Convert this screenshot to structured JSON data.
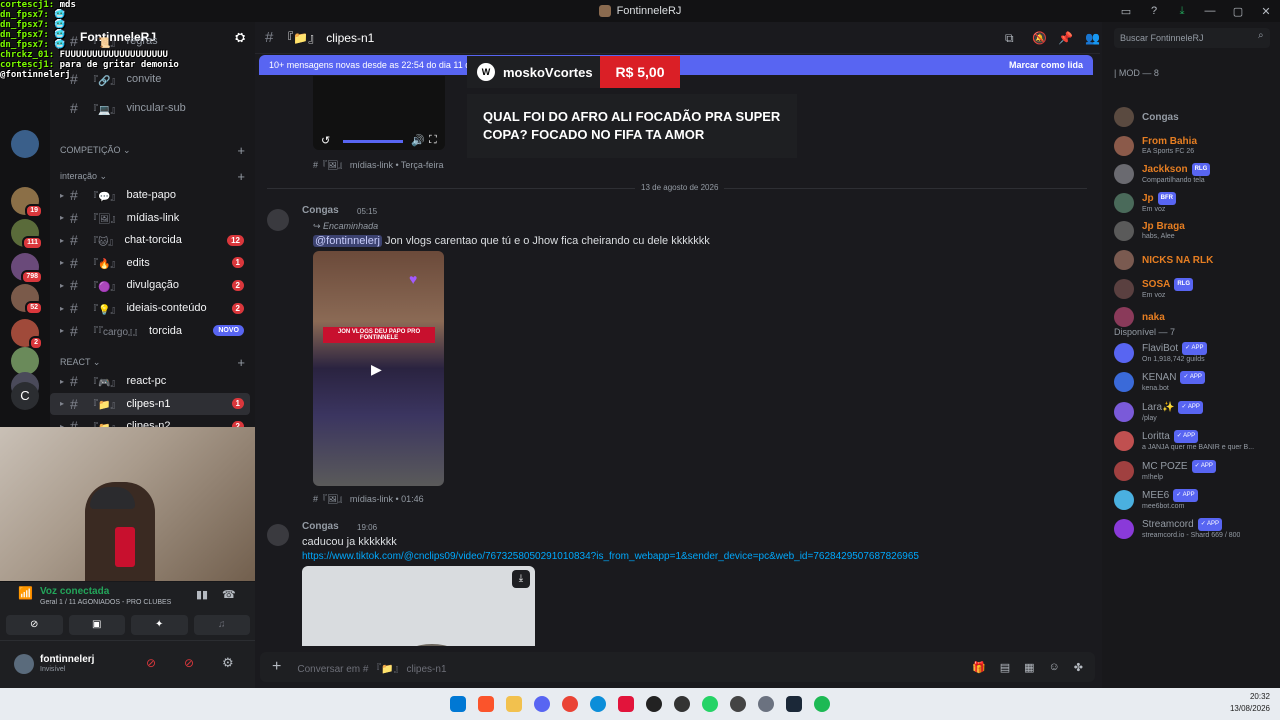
{
  "window": {
    "title": "FontinneleRJ"
  },
  "guild": {
    "name": "FontinneleRJ"
  },
  "overlay": {
    "lines": [
      {
        "user": "cortescj1",
        "text": "mds"
      },
      {
        "user": "dn_fpsx7",
        "text": "🥶"
      },
      {
        "user": "dn_fpsx7",
        "text": "🥶"
      },
      {
        "user": "dn_fpsx7",
        "text": "🥶"
      },
      {
        "user": "dn_fpsx7",
        "text": "🥶"
      },
      {
        "user": "chrckz_01",
        "text": "FUUUUUUUUUUUUUUUUUUU"
      },
      {
        "user": "cortescj1",
        "text": "para de gritar demonio"
      },
      {
        "user": "",
        "text": "@fontinnelerj"
      }
    ]
  },
  "channels": {
    "top_items": [
      {
        "name": "regras",
        "emoji": "📜"
      },
      {
        "name": "convite",
        "emoji": "🔗"
      },
      {
        "name": "vincular-sub",
        "emoji": "💻"
      }
    ],
    "cat_competicao": "COMPETIÇÃO",
    "cat_interacao": "interação",
    "interacao": [
      {
        "name": "bate-papo",
        "emoji": "💬",
        "count": ""
      },
      {
        "name": "mídias-link",
        "emoji": "🖼",
        "count": ""
      },
      {
        "name": "chat-torcida",
        "emoji": "🐱",
        "count": "12"
      },
      {
        "name": "edits",
        "emoji": "🔥",
        "count": "1"
      },
      {
        "name": "divulgação",
        "emoji": "🟣",
        "count": "2"
      },
      {
        "name": "ideiais-conteúdo",
        "emoji": "💡",
        "count": "2"
      },
      {
        "name": "torcida",
        "emoji": "『cargo』",
        "count": "NOVO"
      }
    ],
    "cat_react": "REACT",
    "react": [
      {
        "name": "react-pc",
        "emoji": "🎮",
        "count": ""
      },
      {
        "name": "clipes-n1",
        "emoji": "📁",
        "count": "1"
      },
      {
        "name": "clipes-n2",
        "emoji": "📁",
        "count": "2"
      }
    ]
  },
  "servers": [
    {
      "badge": ""
    },
    {
      "badge": "19"
    },
    {
      "badge": "111"
    },
    {
      "badge": "798"
    },
    {
      "badge": "52"
    },
    {
      "badge": "2"
    },
    {
      "badge": ""
    },
    {
      "badge": ""
    }
  ],
  "server_letter": "C",
  "voice": {
    "status": "Voz conectada",
    "channel": "Geral 1 / 11 AGONIADOS - PRO CLUBES"
  },
  "user": {
    "name": "fontinnelerj",
    "status": "Invisível"
  },
  "chat": {
    "channel": "clipes-n1",
    "banner_text": "10+ mensagens novas desde as 22:54 do dia 11 de agosto de 2026",
    "banner_action": "Marcar como lida",
    "search_placeholder": "Buscar FontinneleRJ",
    "input_placeholder": "Conversar em # 『📁』 clipes-n1",
    "date_divider": "13 de agosto de 2026",
    "prev_meta": "#『🖼』 mídias-link • Terça-feira",
    "messages": [
      {
        "author": "Congas",
        "time": "05:15",
        "forwarded": "Encaminhada",
        "mention": "@fontinnelerj",
        "text": "Jon vlogs carentao que tú e o Jhow fica cheirando cu dele kkkkkkk",
        "embed_caption": "JON VLOGS DEU PAPO PRO FONTINNELE",
        "meta": "#『🖼』 mídias-link • 01:46"
      },
      {
        "author": "Congas",
        "time": "19:06",
        "text": "caducou ja kkkkkkk",
        "link": "https://www.tiktok.com/@cnclips09/video/7673258050291010834?is_from_webapp=1&sender_device=pc&web_id=7628429507687826965"
      }
    ]
  },
  "donation": {
    "channel_letter": "W",
    "name": "moskoVcortes",
    "amount": "R$ 5,00",
    "message": "QUAL FOI DO AFRO ALI FOCADÃO PRA SUPER COPA? FOCADO NO FIFA TA AMOR"
  },
  "members": {
    "mod_header": "| MOD — 8",
    "mods": [
      {
        "name": "Congas",
        "sub": "",
        "color": "#949ba4",
        "tag": ""
      },
      {
        "name": "From Bahia",
        "sub": "EA Sports FC 26",
        "color": "#e67e22",
        "tag": ""
      },
      {
        "name": "Jackkson",
        "sub": "Compartilhando tela",
        "color": "#e67e22",
        "tag": "RLG"
      },
      {
        "name": "Jp",
        "sub": "Em voz",
        "color": "#e67e22",
        "tag": "BFR"
      },
      {
        "name": "Jp Braga",
        "sub": "habs, Alee",
        "color": "#e67e22",
        "tag": ""
      },
      {
        "name": "NICKS NA RLK",
        "sub": "",
        "color": "#e67e22",
        "tag": ""
      },
      {
        "name": "SOSA",
        "sub": "Em voz",
        "color": "#e67e22",
        "tag": "RLG"
      },
      {
        "name": "naka",
        "sub": "",
        "color": "#e67e22",
        "tag": ""
      }
    ],
    "avail_header": "Disponível — 7",
    "avail": [
      {
        "name": "FlaviBot",
        "sub": "On 1,918,742 guilds",
        "tag": "APP"
      },
      {
        "name": "KENAN",
        "sub": "kena.bot",
        "tag": "APP"
      },
      {
        "name": "Lara✨",
        "sub": "/play",
        "tag": "APP"
      },
      {
        "name": "Loritta",
        "sub": "a JANJA quer me BANIR e quer B...",
        "tag": "APP"
      },
      {
        "name": "MC POZE",
        "sub": "m!help",
        "tag": "APP"
      },
      {
        "name": "MEE6",
        "sub": "mee6bot.com",
        "tag": "APP"
      },
      {
        "name": "Streamcord",
        "sub": "streamcord.io - Shard 669 / 800",
        "tag": "APP"
      }
    ]
  },
  "tray": {
    "time": "20:32",
    "date": "13/08/2026"
  }
}
